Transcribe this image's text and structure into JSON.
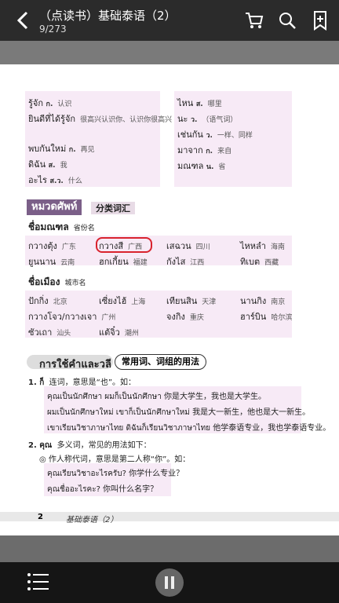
{
  "header": {
    "title": "（点读书）基础泰语（2）",
    "page_indicator": "9/273"
  },
  "vocab_left": [
    {
      "thai": "รู้จัก",
      "pos": "ก.",
      "cn": "认识"
    },
    {
      "thai": "ยินดีที่ได้รู้จัก",
      "pos": "",
      "cn": "很高兴认识你、认识你很高兴"
    },
    {
      "thai": "พบกันใหม่",
      "pos": "ก.",
      "cn": "再见"
    },
    {
      "thai": "ดิฉัน",
      "pos": "ส.",
      "cn": "我"
    },
    {
      "thai": "อะไร",
      "pos": "ส.ว.",
      "cn": "什么"
    }
  ],
  "vocab_right": [
    {
      "thai": "ไหน",
      "pos": "ส.",
      "cn": "哪里"
    },
    {
      "thai": "นะ",
      "pos": "ว.",
      "cn": "（语气词）"
    },
    {
      "thai": "เช่นกัน",
      "pos": "ว.",
      "cn": "一样、同样"
    },
    {
      "thai": "มาจาก",
      "pos": "ก.",
      "cn": "来自"
    },
    {
      "thai": "มณฑล",
      "pos": "น.",
      "cn": "省"
    }
  ],
  "section1": {
    "title_thai": "หมวดศัพท์",
    "title_cn": "分类词汇",
    "provinces_head_thai": "ชื่อมณฑล",
    "provinces_head_cn": "省份名",
    "provinces": [
      {
        "thai": "กวางตุ้ง",
        "cn": "广东"
      },
      {
        "thai": "กวางสี",
        "cn": "广西"
      },
      {
        "thai": "เสฉวน",
        "cn": "四川"
      },
      {
        "thai": "ไหหลำ",
        "cn": "海南"
      },
      {
        "thai": "ยูนนาน",
        "cn": "云南"
      },
      {
        "thai": "ฮกเกี้ยน",
        "cn": "福建"
      },
      {
        "thai": "กังไส",
        "cn": "江西"
      },
      {
        "thai": "ทิเบต",
        "cn": "西藏"
      }
    ],
    "cities_head_thai": "ชื่อเมือง",
    "cities_head_cn": "城市名",
    "cities": [
      {
        "thai": "ปักกิ่ง",
        "cn": "北京"
      },
      {
        "thai": "เซี่ยงไฮ้",
        "cn": "上海"
      },
      {
        "thai": "เทียนสิน",
        "cn": "天津"
      },
      {
        "thai": "นานกิง",
        "cn": "南京"
      },
      {
        "thai": "กวางโจว/กวางเจา",
        "cn": "广州"
      },
      {
        "thai": "จงกิง",
        "cn": "重庆"
      },
      {
        "thai": "ฮาร์บิน",
        "cn": "哈尔滨"
      },
      {
        "thai": "ซัวเถา",
        "cn": "汕头"
      },
      {
        "thai": "แต้จิ๋ว",
        "cn": "潮州"
      }
    ]
  },
  "section2": {
    "title_thai": "การใช้คำและวลี",
    "title_cn": "常用词、词组的用法",
    "item1_head": "1. ก็",
    "item1_desc": "连词，意思是“也”。如：",
    "item1_examples": [
      "คุณเป็นนักศึกษา ผมก็เป็นนักศึกษา  你是大学生，我也是大学生。",
      "ผมเป็นนักศึกษาใหม่ เขาก็เป็นนักศึกษาใหม่  我是大一新生，他也是大一新生。",
      "เขาเรียนวิชาภาษาไทย ดิฉันก็เรียนวิชาภาษาไทย  他学泰语专业，我也学泰语专业。"
    ],
    "item2_head": "2. คุณ",
    "item2_desc": "多义词，常见的用法如下：",
    "item2_sub": "作人称代词，意思是第二人称“你”。如：",
    "item2_examples": [
      "คุณเรียนวิชาอะไรครับ?  你学什么专业？",
      "คุณชื่ออะไรคะ?  你叫什么名字？"
    ]
  },
  "footer": {
    "page_number": "2",
    "book_title": "基础泰语（2）"
  }
}
